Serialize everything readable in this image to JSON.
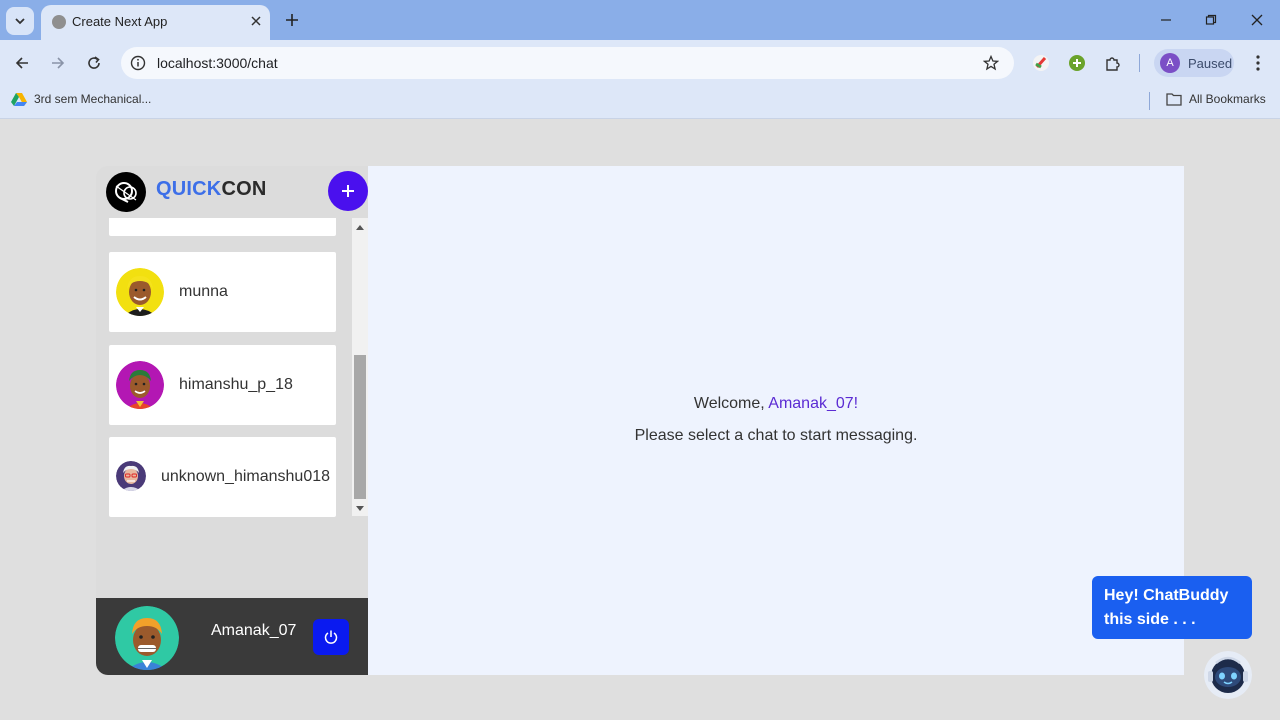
{
  "browser": {
    "tab_title": "Create Next App",
    "url": "localhost:3000/chat",
    "profile_initial": "A",
    "profile_label": "Paused",
    "bookmark_1": "3rd sem Mechanical...",
    "bookmark_all": "All Bookmarks"
  },
  "app": {
    "logo_quick": "QUICK",
    "logo_con": "CON",
    "chats": [
      {
        "name": "munna"
      },
      {
        "name": "himanshu_p_18"
      },
      {
        "name": "unknown_himanshu018"
      }
    ],
    "current_user": "Amanak_07"
  },
  "main": {
    "welcome_prefix": "Welcome, ",
    "welcome_user": "Amanak_07!",
    "prompt": "Please select a chat to start messaging."
  },
  "chatbot": {
    "bubble_text": "Hey! ChatBuddy this side . . ."
  },
  "colors": {
    "accent_purple": "#4a10ee",
    "logout_blue": "#0a1af0",
    "chatbot_blue": "#1a5ff0",
    "logo_blue": "#3d6fe8"
  },
  "icons": [
    "tab-search-icon",
    "close-icon",
    "plus-icon",
    "minimize-icon",
    "restore-icon",
    "back-icon",
    "forward-icon",
    "reload-icon",
    "info-icon",
    "star-icon",
    "extensions-icon",
    "kebab-menu-icon",
    "drive-icon",
    "folder-icon",
    "power-icon",
    "robot-icon"
  ]
}
